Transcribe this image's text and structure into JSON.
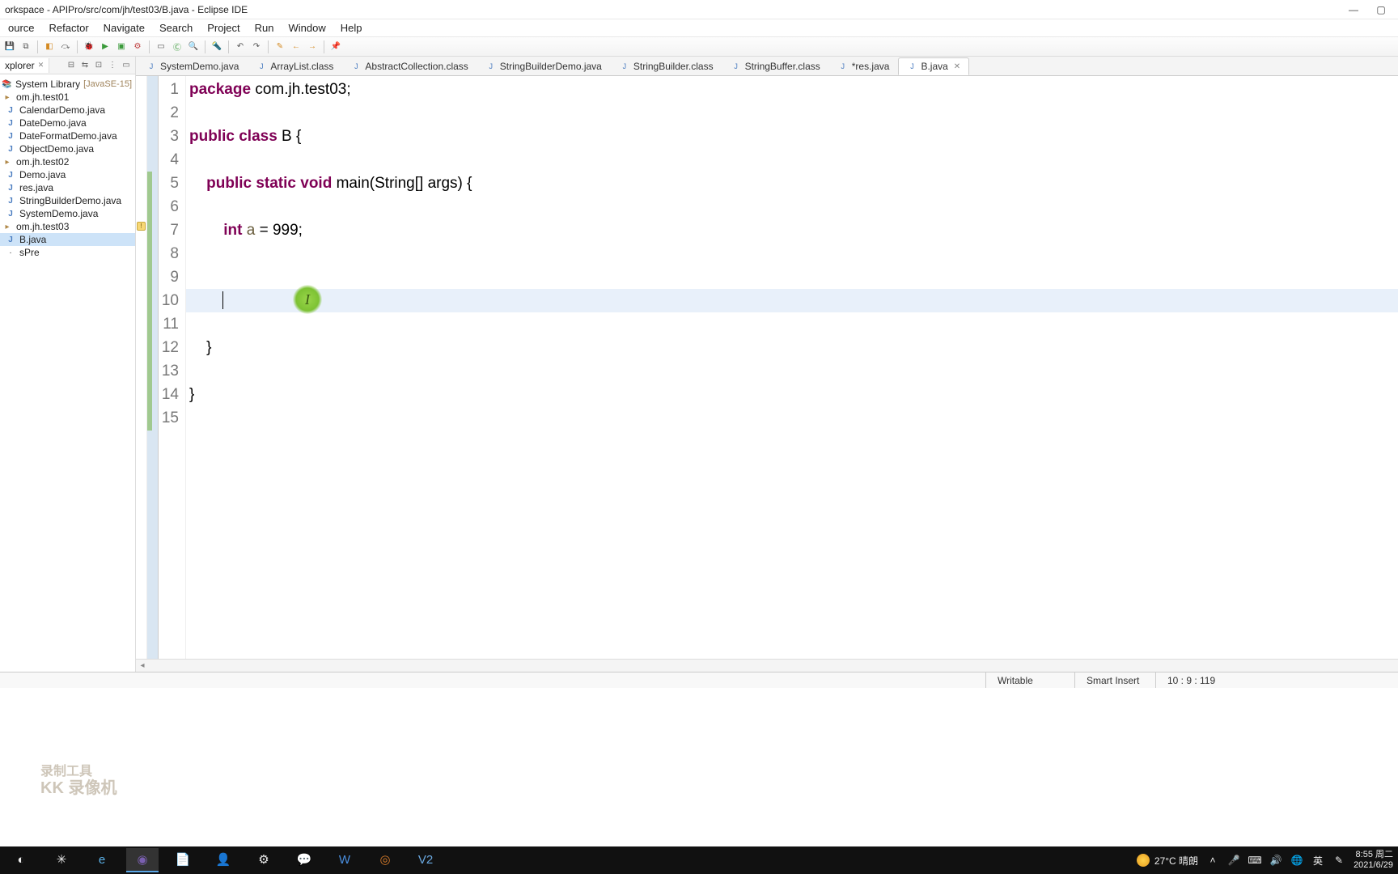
{
  "window": {
    "title": "orkspace - APIPro/src/com/jh/test03/B.java - Eclipse IDE"
  },
  "menu": {
    "items": [
      "ource",
      "Refactor",
      "Navigate",
      "Search",
      "Project",
      "Run",
      "Window",
      "Help"
    ]
  },
  "explorer": {
    "tab": "xplorer",
    "library_label": "System Library",
    "jre_tag": "[JavaSE-15]",
    "nodes": [
      {
        "kind": "pkg",
        "label": "om.jh.test01"
      },
      {
        "kind": "java",
        "label": "CalendarDemo.java"
      },
      {
        "kind": "java",
        "label": "DateDemo.java"
      },
      {
        "kind": "java",
        "label": "DateFormatDemo.java"
      },
      {
        "kind": "java",
        "label": "ObjectDemo.java"
      },
      {
        "kind": "pkg",
        "label": "om.jh.test02"
      },
      {
        "kind": "java",
        "label": "Demo.java"
      },
      {
        "kind": "java",
        "label": "res.java"
      },
      {
        "kind": "java",
        "label": "StringBuilderDemo.java"
      },
      {
        "kind": "java",
        "label": "SystemDemo.java"
      },
      {
        "kind": "pkg",
        "label": "om.jh.test03"
      },
      {
        "kind": "java",
        "label": "B.java",
        "selected": true
      },
      {
        "kind": "other",
        "label": "sPre"
      }
    ]
  },
  "tabs": [
    {
      "label": "SystemDemo.java"
    },
    {
      "label": "ArrayList.class"
    },
    {
      "label": "AbstractCollection.class"
    },
    {
      "label": "StringBuilderDemo.java"
    },
    {
      "label": "StringBuilder.class"
    },
    {
      "label": "StringBuffer.class"
    },
    {
      "label": "*res.java"
    },
    {
      "label": "B.java",
      "active": true
    }
  ],
  "code": {
    "lines": [
      {
        "n": 1,
        "segs": [
          {
            "t": "package ",
            "c": "kw"
          },
          {
            "t": "com.jh.test03;",
            "c": ""
          }
        ]
      },
      {
        "n": 2,
        "segs": []
      },
      {
        "n": 3,
        "segs": [
          {
            "t": "public class ",
            "c": "kw"
          },
          {
            "t": "B {",
            "c": ""
          }
        ]
      },
      {
        "n": 4,
        "segs": []
      },
      {
        "n": 5,
        "segs": [
          {
            "t": "    ",
            "c": ""
          },
          {
            "t": "public static void ",
            "c": "kw"
          },
          {
            "t": "main(String[] args) {",
            "c": ""
          }
        ]
      },
      {
        "n": 6,
        "segs": []
      },
      {
        "n": 7,
        "segs": [
          {
            "t": "        ",
            "c": ""
          },
          {
            "t": "int ",
            "c": "kw"
          },
          {
            "t": "a",
            "c": "var-warn"
          },
          {
            "t": " = 999;",
            "c": ""
          }
        ]
      },
      {
        "n": 8,
        "segs": []
      },
      {
        "n": 9,
        "segs": []
      },
      {
        "n": 10,
        "segs": [
          {
            "t": "        ",
            "c": ""
          }
        ],
        "current": true,
        "caret": true
      },
      {
        "n": 11,
        "segs": []
      },
      {
        "n": 12,
        "segs": [
          {
            "t": "    }",
            "c": ""
          }
        ]
      },
      {
        "n": 13,
        "segs": []
      },
      {
        "n": 14,
        "segs": [
          {
            "t": "}",
            "c": ""
          }
        ]
      },
      {
        "n": 15,
        "segs": []
      }
    ]
  },
  "status": {
    "writable": "Writable",
    "insert": "Smart Insert",
    "pos": "10 : 9 : 119"
  },
  "system": {
    "weather": "27°C 晴朗",
    "time": "8:55 周二",
    "date": "2021/6/29"
  },
  "watermark": {
    "l1": "录制工具",
    "l2": "KK 录像机"
  }
}
